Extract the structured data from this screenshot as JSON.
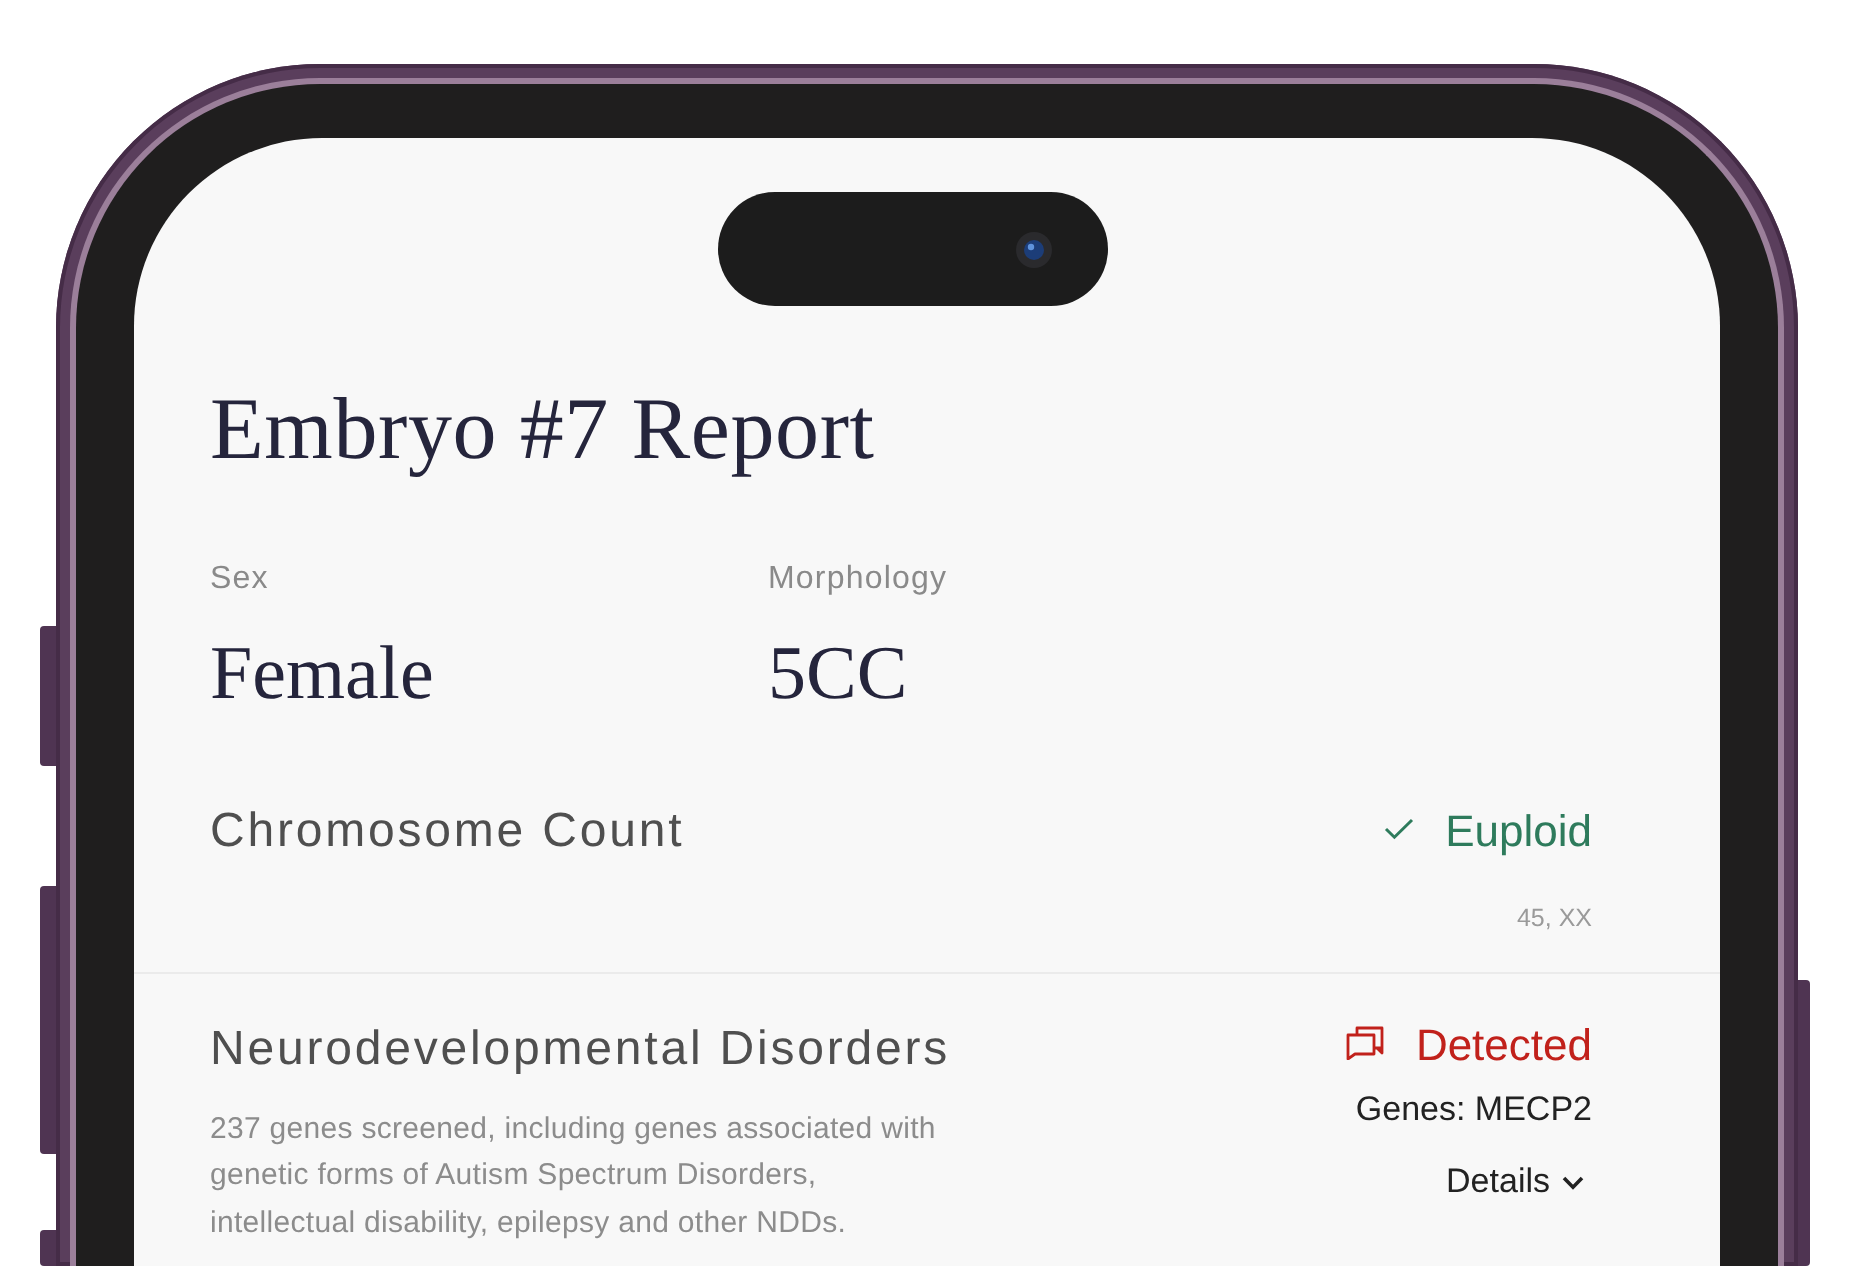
{
  "report": {
    "title": "Embryo #7 Report"
  },
  "attributes": [
    {
      "label": "Sex",
      "value": "Female"
    },
    {
      "label": "Morphology",
      "value": "5CC"
    }
  ],
  "sections": [
    {
      "title": "Chromosome Count",
      "result": {
        "kind": "check",
        "text": "Euploid",
        "color": "#2e7b5c"
      },
      "note": "45, XX"
    },
    {
      "title": "Neurodevelopmental Disorders",
      "description": "237 genes screened, including genes associated with\ngenetic forms of Autism Spectrum Disorders,\nintellectual disability, epilepsy and other NDDs.",
      "result": {
        "kind": "alert",
        "text": "Detected",
        "color": "#c1211b"
      },
      "genes": "Genes: MECP2",
      "details": {
        "label": "Details",
        "expanded": false
      }
    }
  ]
}
